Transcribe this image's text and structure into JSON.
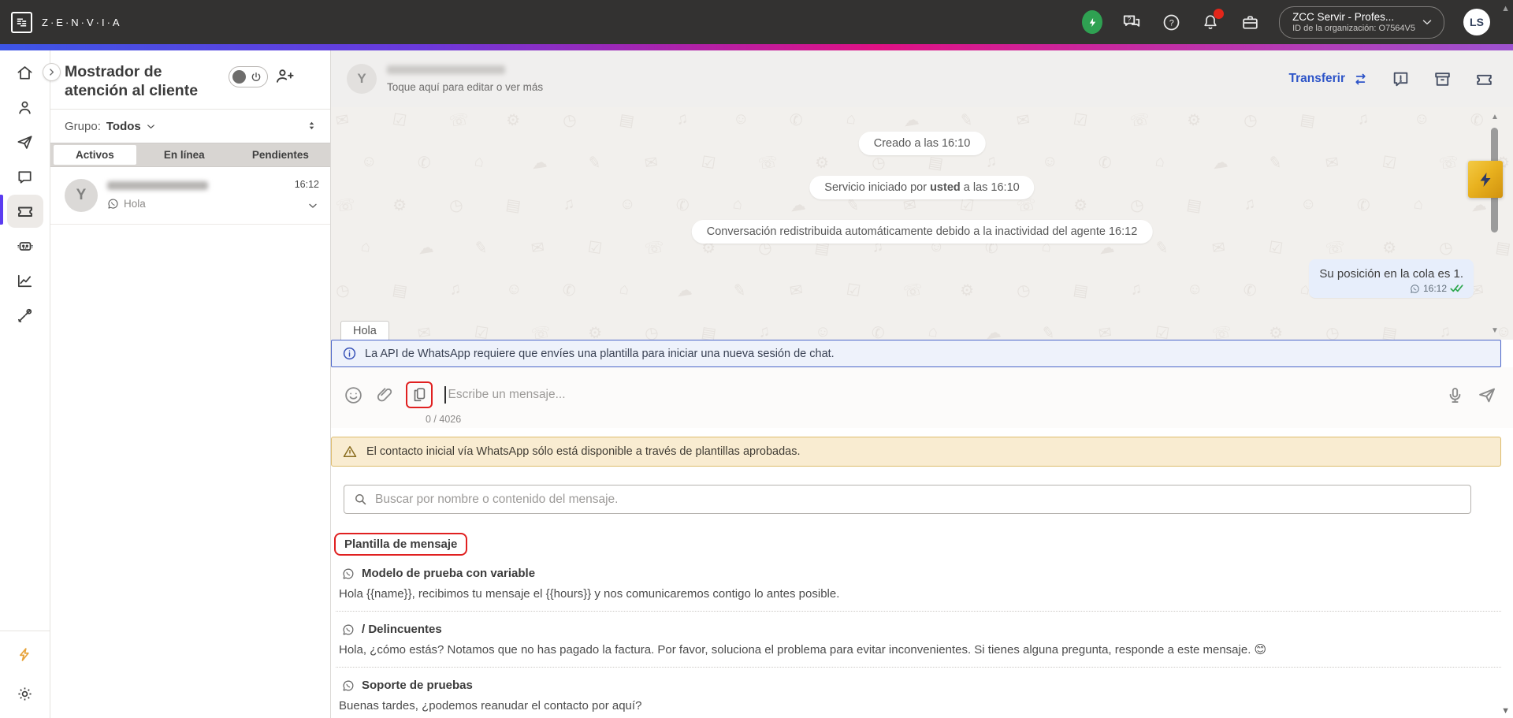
{
  "topbar": {
    "brand": "Z·E·N·V·I·A",
    "org_name": "ZCC Servir - Profes...",
    "org_id": "ID de la organización: O7564V5",
    "avatar_initials": "LS"
  },
  "left_panel": {
    "title": "Mostrador de atención al cliente",
    "group_label": "Grupo:",
    "group_value": "Todos",
    "tabs": {
      "0": "Activos",
      "1": "En línea",
      "2": "Pendientes"
    },
    "active_tab": "Activos",
    "conversation": {
      "avatar_initial": "Y",
      "time": "16:12",
      "preview": "Hola"
    }
  },
  "chat": {
    "header": {
      "avatar_initial": "Y",
      "subtitle": "Toque aquí para editar o ver más"
    },
    "transfer_label": "Transferir",
    "system_messages": {
      "created": "Creado a las 16:10",
      "service_prefix": "Servicio iniciado por ",
      "service_bold": "usted",
      "service_suffix": " a las 16:10",
      "redistributed": "Conversación redistribuida automáticamente debido a la inactividad del agente 16:12"
    },
    "outgoing_message": {
      "text": "Su posición en la cola es 1.",
      "time": "16:12"
    },
    "draft_snippet": "Hola"
  },
  "composer": {
    "info_banner": "La API de WhatsApp requiere que envíes una plantilla para iniciar una nueva sesión de chat.",
    "input_placeholder": "Escribe un mensaje...",
    "char_counter": "0 / 4026",
    "warning_banner": "El contacto inicial vía WhatsApp sólo está disponible a través de plantillas aprobadas."
  },
  "templates": {
    "search_placeholder": "Buscar por nombre o contenido del mensaje.",
    "section_label": "Plantilla de mensaje",
    "items": [
      {
        "name": "Modelo de prueba con variable",
        "body": "Hola {{name}}, recibimos tu mensaje el {{hours}} y nos comunicaremos contigo lo antes posible."
      },
      {
        "name": "/ Delincuentes",
        "body": "Hola, ¿cómo estás? Notamos que no has pagado la factura. Por favor, soluciona el problema para evitar inconvenientes. Si tienes alguna pregunta, responde a este mensaje. 😊"
      },
      {
        "name": "Soporte de pruebas",
        "body": "Buenas tardes, ¿podemos reanudar el contacto por aquí?"
      }
    ]
  },
  "icons": {
    "rail": [
      "home-icon",
      "contacts-icon",
      "send-icon",
      "chat-icon",
      "ticket-icon",
      "bot-icon",
      "analytics-icon",
      "tools-icon",
      "flash-icon",
      "settings-icon"
    ],
    "topbar": [
      "status-bolt-icon",
      "live-chat-help-icon",
      "help-icon",
      "notifications-bell-icon",
      "briefcase-icon"
    ],
    "chat_header": [
      "feedback-icon",
      "archive-icon",
      "ticket-icon"
    ],
    "composer": [
      "emoji-icon",
      "attachment-icon",
      "template-copy-icon",
      "microphone-icon",
      "send-plane-icon"
    ]
  },
  "colors": {
    "highlight_red": "#e02020",
    "brand_green": "#2fa152",
    "warning_bg": "#f9ecd1",
    "info_bg": "#eef2fb",
    "outgoing_bubble": "#e7eefb",
    "rail_active_accent": "#5b3cf0",
    "badge_gold": "#e9b21f",
    "transfer_blue": "#2d54c8",
    "check_green": "#2fa84f"
  }
}
